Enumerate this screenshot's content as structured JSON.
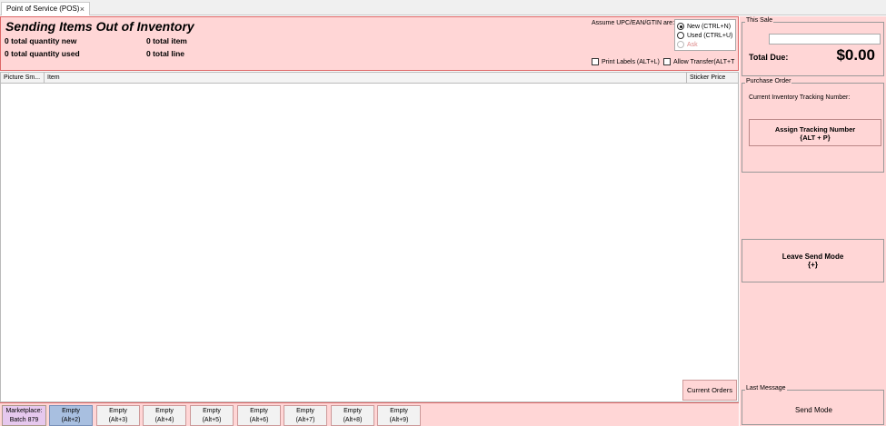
{
  "tab": {
    "title": "Point of Service (POS)",
    "close": "×"
  },
  "header": {
    "title": "Sending Items Out of Inventory",
    "qty_new": "0 total quantity new",
    "qty_used": "0 total quantity used",
    "total_item": "0 total item",
    "total_line": "0 total line",
    "assume_label": "Assume UPC/EAN/GTIN are:",
    "radio_new": "New (CTRL+N)",
    "radio_used": "Used (CTRL+U)",
    "radio_ask": "Ask",
    "selected": "new",
    "print_labels": "Print Labels (ALT+L)",
    "allow_transfer": "Allow Transfer(ALT+T"
  },
  "grid": {
    "columns": [
      "Picture Sm...",
      "Item",
      "Sticker Price"
    ],
    "rows": [],
    "current_orders": "Current Orders"
  },
  "footer": {
    "batch_line1": "Marketplace:",
    "batch_line2": "Batch 879",
    "slots": [
      {
        "label": "Empty",
        "key": "(Alt+2)"
      },
      {
        "label": "Empty",
        "key": "(Alt+3)"
      },
      {
        "label": "Empty",
        "key": "(Alt+4)"
      },
      {
        "label": "Empty",
        "key": "(Alt+5)"
      },
      {
        "label": "Empty",
        "key": "(Alt+6)"
      },
      {
        "label": "Empty",
        "key": "(Alt+7)"
      },
      {
        "label": "Empty",
        "key": "(Alt+8)"
      },
      {
        "label": "Empty",
        "key": "(Alt+9)"
      }
    ],
    "active_slot": 0
  },
  "side": {
    "this_sale": "This Sale",
    "sale_input_value": "",
    "total_due_label": "Total Due:",
    "total_due_value": "$0.00",
    "purchase_order": "Purchase Order",
    "tracking_label": "Current Inventory Tracking Number:",
    "assign_line1": "Assign Tracking Number",
    "assign_line2": "{ALT + P}",
    "leave_line1": "Leave Send Mode",
    "leave_line2": "{+}",
    "last_message": "Last Message",
    "last_message_text": "Send Mode"
  },
  "colors": {
    "panel_bg": "#ffd6d6",
    "panel_border": "#dd6666",
    "active_slot": "#a8bfe0",
    "batch_bg": "#e6c8ee"
  }
}
